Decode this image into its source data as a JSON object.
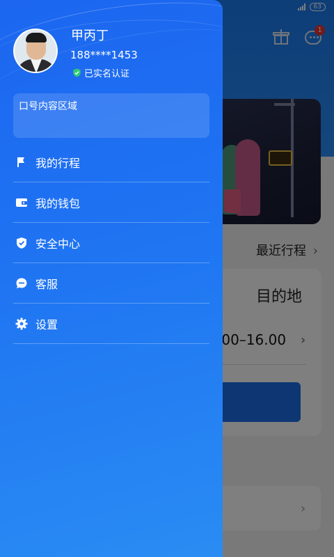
{
  "background": {
    "battery": "63",
    "badge_count": "1",
    "recent_trips_label": "最近行程",
    "destination_label": "目的地",
    "time_range": ".00–16.00",
    "chevron": "›"
  },
  "drawer": {
    "user": {
      "name": "甲丙丁",
      "phone": "188****1453",
      "verified_label": "已实名认证"
    },
    "content_area_label": "口号内容区域",
    "menu": [
      {
        "label": "我的行程",
        "icon": "flag-icon"
      },
      {
        "label": "我的钱包",
        "icon": "wallet-icon"
      },
      {
        "label": "安全中心",
        "icon": "shield-icon"
      },
      {
        "label": "客服",
        "icon": "chat-icon"
      },
      {
        "label": "设置",
        "icon": "gear-icon"
      }
    ]
  },
  "colors": {
    "drawer_top": "#1c66f0",
    "drawer_bottom": "#2a8cf3",
    "verified_green": "#2ecc71",
    "badge_red": "#e8332f"
  }
}
